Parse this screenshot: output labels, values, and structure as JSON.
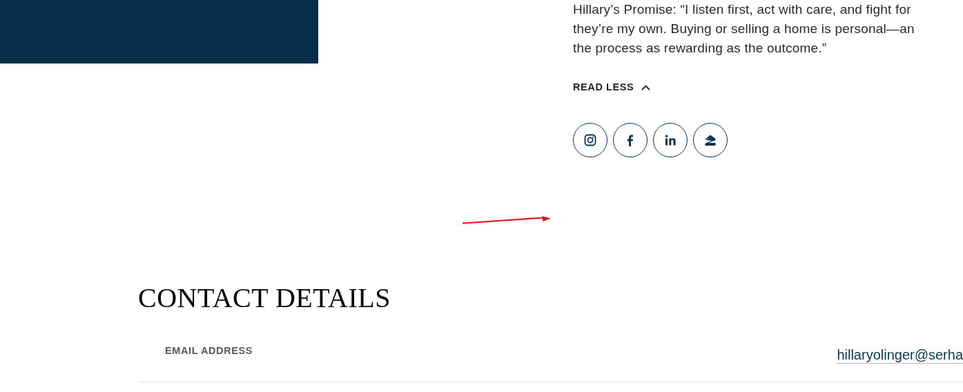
{
  "promise": {
    "lines": [
      "Hillary’s Promise: “I listen first, act with care, and fight for",
      "they’re my own. Buying or selling a home is personal—an",
      "the process as rewarding as the outcome.”"
    ]
  },
  "toggle": {
    "label": "READ LESS",
    "expanded": true
  },
  "social_links": [
    {
      "kind": "instagram"
    },
    {
      "kind": "facebook"
    },
    {
      "kind": "linkedin"
    },
    {
      "kind": "house"
    }
  ],
  "contact": {
    "heading": "CONTACT DETAILS",
    "rows": [
      {
        "label": "EMAIL ADDRESS",
        "value": "hillaryolinger@serha"
      }
    ]
  }
}
